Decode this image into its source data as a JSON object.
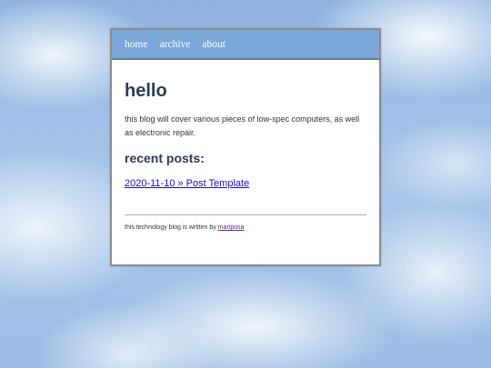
{
  "nav": {
    "items": [
      {
        "label": "home"
      },
      {
        "label": "archive"
      },
      {
        "label": "about"
      }
    ]
  },
  "main": {
    "title": "hello",
    "description": "this blog will cover various pieces of low-spec computers, as well as electronic repair.",
    "recent_heading": "recent posts:",
    "posts": [
      {
        "date": "2020-11-10",
        "separator": "»",
        "title": "Post Template",
        "link_text": "2020-11-10 » Post Template"
      }
    ]
  },
  "footer": {
    "text": "this technology blog is written by",
    "author_link": "mariposa"
  },
  "colors": {
    "nav_background": "#7ba8d8",
    "heading": "#2e3a55",
    "link": "#1a0dcc",
    "visited_link": "#5b2b8a"
  }
}
